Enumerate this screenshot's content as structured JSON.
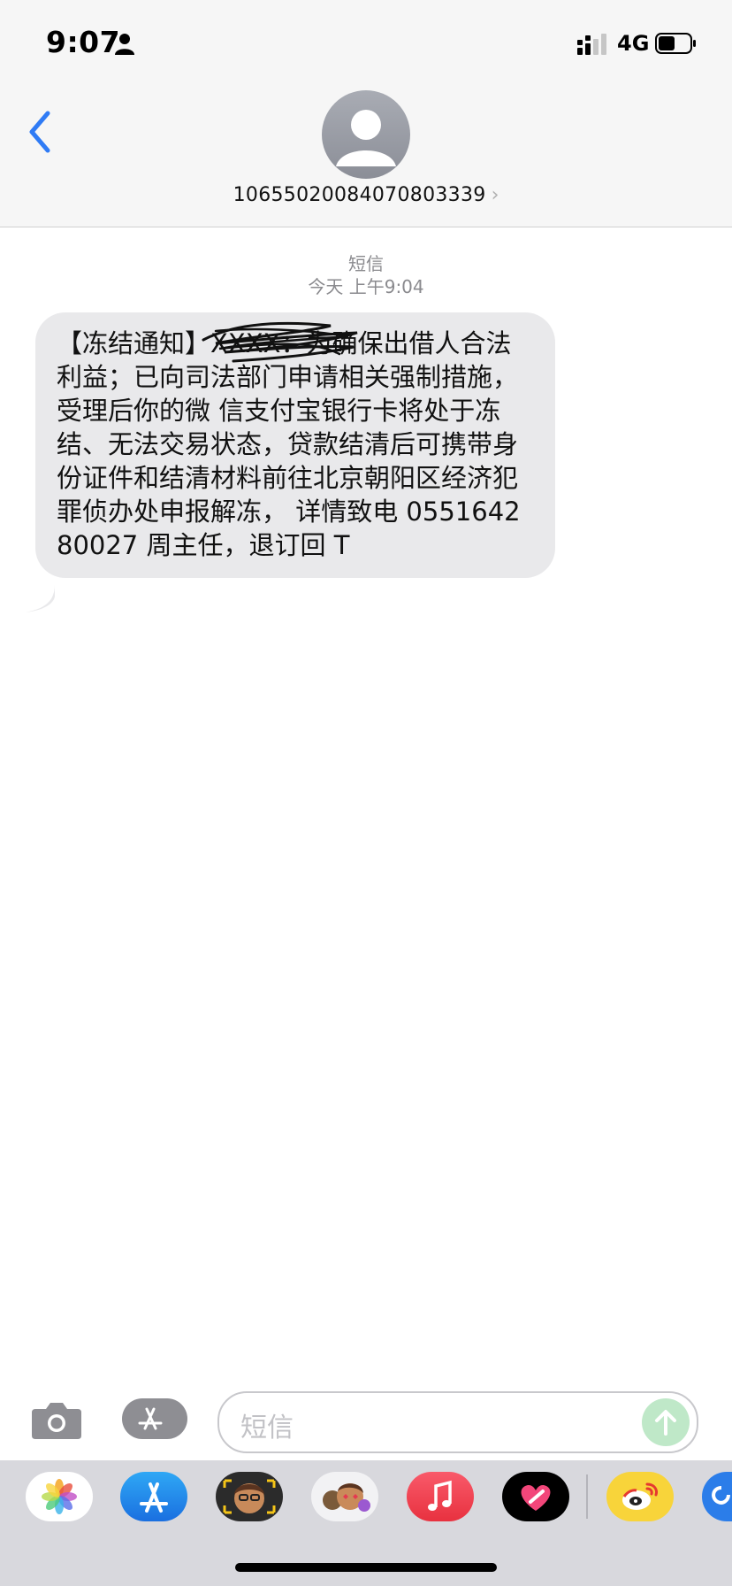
{
  "status_bar": {
    "time": "9:07",
    "network": "4G",
    "icons": [
      "person-icon",
      "signal-bars-icon",
      "battery-icon"
    ]
  },
  "header": {
    "back_icon": "chevron-left-icon",
    "contact_number": "10655020084070803339",
    "contact_chevron": "›",
    "accent_color": "#2f7bf5"
  },
  "thread": {
    "label": "短信",
    "timestamp": "今天 上午9:04"
  },
  "message": {
    "text": "【冻结通知】XXXX：为确保出借人合法利益；已向司法部门申请相关强制措施，受理后你的微 信支付宝银行卡将处于冻结、无法交易状态，贷款结清后可携带身份证件和结清材料前往北京朝阳区经济犯罪侦办处申报解冻， 详情致电 055164280027 周主任，退订回 T",
    "redacted": true
  },
  "input_bar": {
    "placeholder": "短信",
    "camera_icon": "camera-icon",
    "apps_icon": "app-store-icon",
    "send_icon": "arrow-up-icon"
  },
  "app_drawer": {
    "apps": [
      {
        "name": "photos-app-icon"
      },
      {
        "name": "app-store-app-icon"
      },
      {
        "name": "memoji-app-icon"
      },
      {
        "name": "animoji-app-icon"
      },
      {
        "name": "music-app-icon"
      },
      {
        "name": "digital-touch-app-icon"
      },
      {
        "name": "weibo-app-icon"
      },
      {
        "name": "extra-app-icon"
      }
    ]
  }
}
